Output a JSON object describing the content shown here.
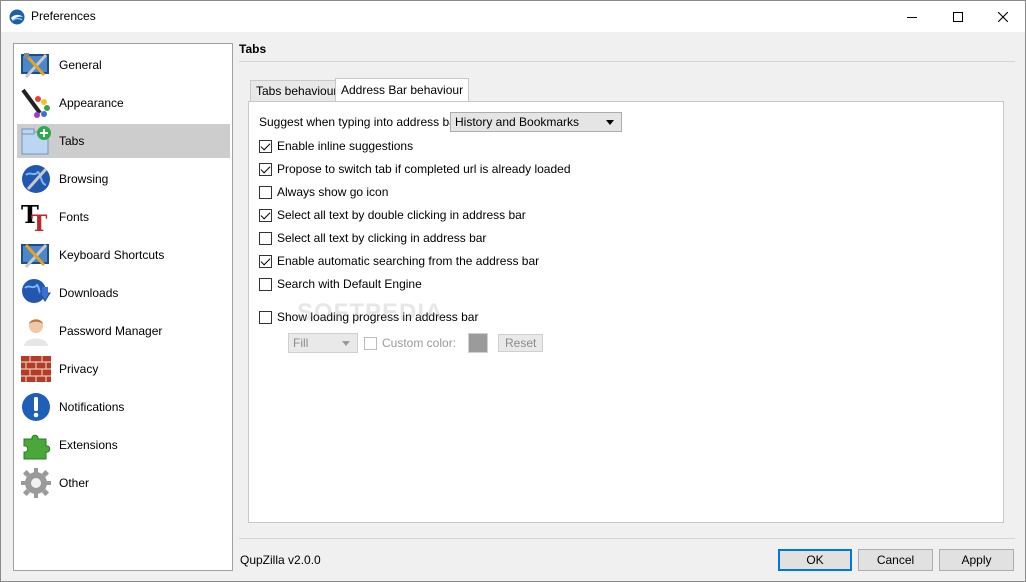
{
  "window": {
    "title": "Preferences"
  },
  "sidebar": {
    "items": [
      {
        "label": "General",
        "icon": "general-icon"
      },
      {
        "label": "Appearance",
        "icon": "appearance-icon"
      },
      {
        "label": "Tabs",
        "icon": "tabs-icon",
        "selected": true
      },
      {
        "label": "Browsing",
        "icon": "browsing-icon"
      },
      {
        "label": "Fonts",
        "icon": "fonts-icon"
      },
      {
        "label": "Keyboard Shortcuts",
        "icon": "keyboard-shortcuts-icon"
      },
      {
        "label": "Downloads",
        "icon": "downloads-icon"
      },
      {
        "label": "Password Manager",
        "icon": "password-manager-icon"
      },
      {
        "label": "Privacy",
        "icon": "privacy-icon"
      },
      {
        "label": "Notifications",
        "icon": "notifications-icon"
      },
      {
        "label": "Extensions",
        "icon": "extensions-icon"
      },
      {
        "label": "Other",
        "icon": "other-icon"
      }
    ]
  },
  "page": {
    "title": "Tabs"
  },
  "tabs": [
    {
      "label": "Tabs behaviour",
      "active": false
    },
    {
      "label": "Address Bar behaviour",
      "active": true
    }
  ],
  "address_bar": {
    "suggest_label": "Suggest when typing into address bar:",
    "suggest_value": "History and Bookmarks",
    "options": [
      {
        "label": "Enable inline suggestions",
        "checked": true
      },
      {
        "label": "Propose to switch tab if completed url is already loaded",
        "checked": true
      },
      {
        "label": "Always show go icon",
        "checked": false
      },
      {
        "label": "Select all text by double clicking in address bar",
        "checked": true
      },
      {
        "label": "Select all text by clicking in address bar",
        "checked": false
      },
      {
        "label": "Enable automatic searching from the address bar",
        "checked": true
      },
      {
        "label": "Search with Default Engine",
        "checked": false
      }
    ],
    "loading_progress": {
      "label": "Show loading progress in address bar",
      "checked": false,
      "style_value": "Fill",
      "custom_color_label": "Custom color:",
      "custom_color_checked": false,
      "reset_label": "Reset"
    }
  },
  "watermark": "SOFTPEDIA",
  "footer": {
    "version": "QupZilla v2.0.0",
    "ok_label": "OK",
    "cancel_label": "Cancel",
    "apply_label": "Apply"
  },
  "colors": {
    "accent": "#0078d7",
    "selected_bg": "#cdcdcd"
  }
}
